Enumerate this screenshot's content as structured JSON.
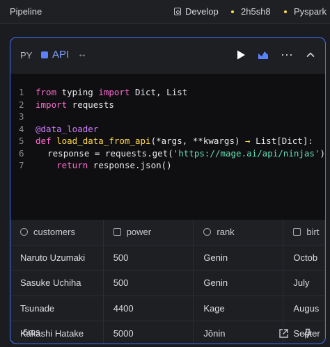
{
  "topbar": {
    "title": "Pipeline",
    "branch": "Develop",
    "commit": "2h5sh8",
    "engine": "Pyspark"
  },
  "block": {
    "language": "PY",
    "name": "API",
    "expand_glyph": "↔",
    "more_glyph": "⋯",
    "run_icon": "play-icon",
    "chart_icon": "chart-icon",
    "collapse_icon": "chevron-up-icon",
    "accent_color": "#3f73ff"
  },
  "code": {
    "lines": [
      {
        "n": "1"
      },
      {
        "n": "2"
      },
      {
        "n": "3"
      },
      {
        "n": "4"
      },
      {
        "n": "5"
      },
      {
        "n": "6"
      },
      {
        "n": "7"
      }
    ],
    "tokens": {
      "l1_from": "from",
      "l1_mod": " typing ",
      "l1_import": "import",
      "l1_rest": " Dict, List",
      "l2_import": "import",
      "l2_rest": " requests",
      "l4_dec": "@data_loader",
      "l5_def": "def",
      "l5_fn": " load_data_from_api",
      "l5_a": "(*args, **kwargs) ",
      "l5_arrow": "→",
      "l5_b": " List[Dict]:",
      "l6_a": "    response = requests.get(",
      "l6_str": "'https://mage.ai/api/ninjas'",
      "l6_b": ")",
      "l7_ret": "    return",
      "l7_rest": " response.json()"
    }
  },
  "table": {
    "columns": [
      "customers",
      "power",
      "rank",
      "birt"
    ],
    "rows": [
      [
        "Naruto Uzumaki",
        "500",
        "Genin",
        "Octob"
      ],
      [
        "Sasuke Uchiha",
        "500",
        "Genin",
        "July"
      ],
      [
        "Tsunade",
        "4400",
        "Kage",
        "Augus"
      ],
      [
        "Kakashi Hatake",
        "5000",
        "Jōnin",
        "Septer"
      ]
    ]
  },
  "footer": {
    "time": "6ms"
  }
}
